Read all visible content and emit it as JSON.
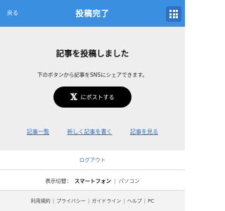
{
  "header": {
    "back_label": "戻る",
    "title": "投稿完了",
    "menu_icon": "grid-menu-icon"
  },
  "main": {
    "title": "記事を投稿しました",
    "description": "下のボタンから記事をSNSにシェアできます。",
    "post_button": {
      "logo": "𝕏",
      "label": "にポストする"
    },
    "links": [
      {
        "label": "記事一覧"
      },
      {
        "label": "新しく記事を書く"
      },
      {
        "label": "記事を見る"
      }
    ]
  },
  "logout": {
    "label": "ログアウト"
  },
  "display_switch": {
    "label": "表示切替：",
    "current": "スマートフォン",
    "separator": "|",
    "alternate": "パソコン"
  },
  "footer": {
    "items": [
      "利用規約",
      "プライバシー",
      "ガイドライン",
      "ヘルプ",
      "PC"
    ],
    "separator": "|"
  },
  "colors": {
    "header_bg": "#3b8fe0",
    "menu_bg": "#2f6fc4",
    "link": "#2f6fc4",
    "main_bg": "#eeeeee",
    "button_bg": "#000000"
  }
}
